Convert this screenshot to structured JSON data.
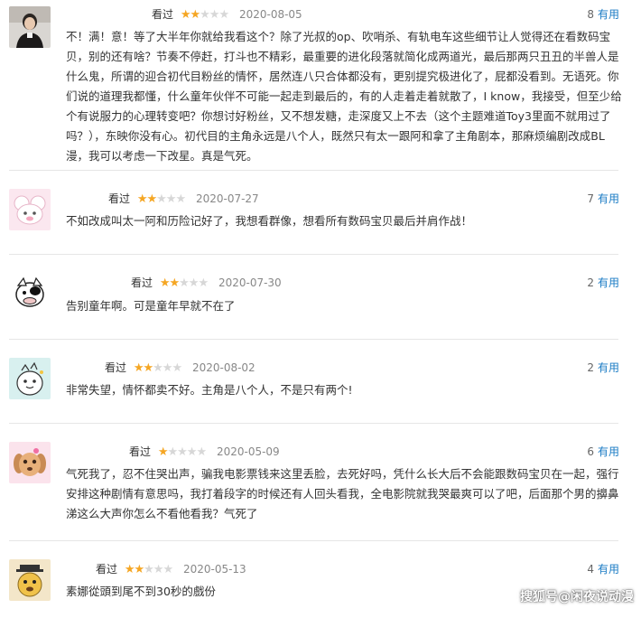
{
  "reviews": [
    {
      "user": "看过",
      "rating": 2,
      "date": "2020-08-05",
      "useful_count": "8",
      "useful_label": "有用",
      "avatar": "user-photo",
      "text": "不！满！意！等了大半年你就给我看这个？除了光叔的op、吹哨杀、有轨电车这些细节让人觉得还在看数码宝贝，别的还有啥？节奏不停赶，打斗也不精彩，最重要的进化段落就简化成两道光，最后那两只丑丑的半兽人是什么鬼，所谓的迎合初代目粉丝的情怀，居然连八只合体都没有，更别提究极进化了，屁都没看到。无语死。你们说的道理我都懂，什么童年伙伴不可能一起走到最后的，有的人走着走着就散了，I know，我接受，但至少给个有说服力的心理转变吧？你想讨好粉丝，又不想发糖，走深度又上不去（这个主题难道Toy3里面不就用过了吗？），东映你没有心。初代目的主角永远是八个人，既然只有太一跟阿和拿了主角剧本，那麻烦编剧改成BL漫，我可以考虑一下改星。真是气死。"
    },
    {
      "user": "看过",
      "rating": 2,
      "date": "2020-07-27",
      "useful_count": "7",
      "useful_label": "有用",
      "avatar": "pink-sheep-cartoon",
      "text": "不如改成叫太一阿和历险记好了，我想看群像，想看所有数码宝贝最后并肩作战！"
    },
    {
      "user": "看过",
      "rating": 2,
      "date": "2020-07-30",
      "useful_count": "2",
      "useful_label": "有用",
      "avatar": "cow-cartoon",
      "text": "告别童年啊。可是童年早就不在了"
    },
    {
      "user": "看过",
      "rating": 2,
      "date": "2020-08-02",
      "useful_count": "2",
      "useful_label": "有用",
      "avatar": "dinosaur-cartoon",
      "text": "非常失望，情怀都卖不好。主角是八个人，不是只有两个!"
    },
    {
      "user": "看过",
      "rating": 1,
      "date": "2020-05-09",
      "useful_count": "6",
      "useful_label": "有用",
      "avatar": "dog-cartoon",
      "text": "气死我了，忍不住哭出声，骗我电影票钱来这里丢脸，去死好吗，凭什么长大后不会能跟数码宝贝在一起，强行安排这种剧情有意思吗，我打着段字的时候还有人回头看我，全电影院就我哭最爽可以了吧，后面那个男的擤鼻涕这么大声你怎么不看他看我？气死了"
    },
    {
      "user": "看过",
      "rating": 2,
      "date": "2020-05-13",
      "useful_count": "4",
      "useful_label": "有用",
      "avatar": "yellow-dog-cartoon",
      "text": "素娜從頭到尾不到30秒的戲份"
    }
  ],
  "watermark": "搜狐号@闲夜说动漫"
}
